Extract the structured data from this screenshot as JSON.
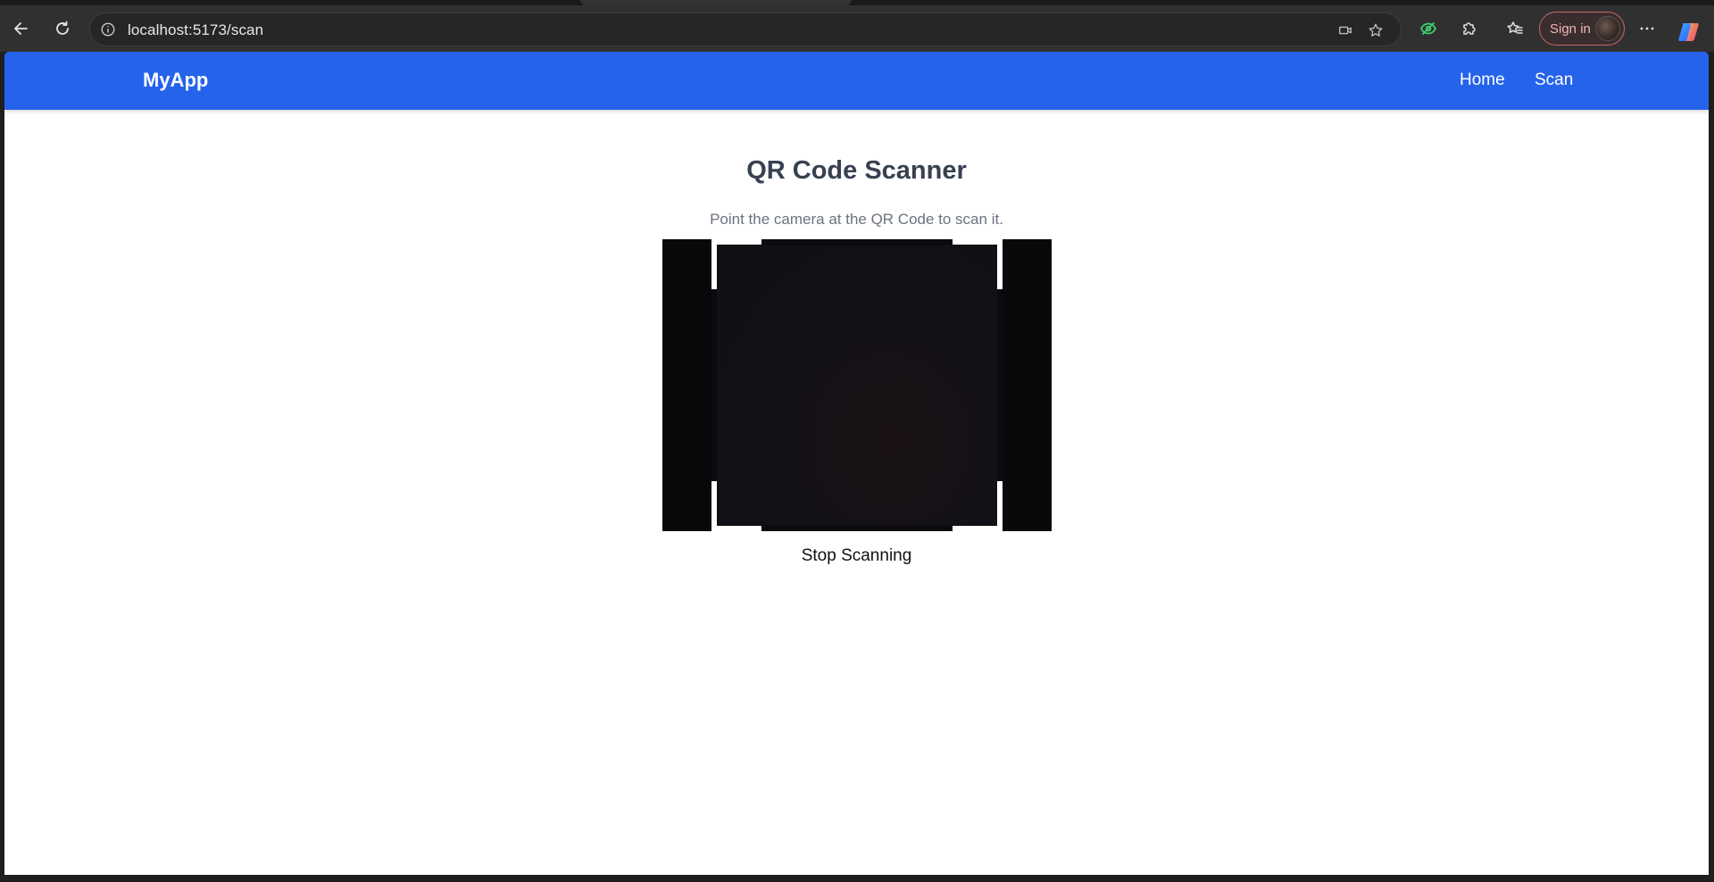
{
  "browser": {
    "url": "localhost:5173/scan",
    "signin_label": "Sign in",
    "accent_color": "#2563eb"
  },
  "app": {
    "brand": "MyApp",
    "nav": [
      {
        "label": "Home"
      },
      {
        "label": "Scan"
      }
    ]
  },
  "main": {
    "title": "QR Code Scanner",
    "subtitle": "Point the camera at the QR Code to scan it.",
    "stop_label": "Stop Scanning"
  },
  "icons": {
    "back": "back-arrow-icon",
    "reload": "reload-icon",
    "site_info": "info-icon",
    "camera": "camera-icon",
    "favorite": "star-icon",
    "tracking": "eye-icon",
    "extensions": "puzzle-icon",
    "favorites": "favorites-icon",
    "menu": "more-icon",
    "copilot": "copilot-icon"
  }
}
